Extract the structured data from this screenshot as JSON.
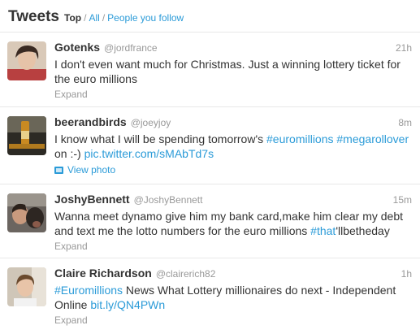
{
  "header": {
    "title": "Tweets",
    "filter_top": "Top",
    "sep1": "/",
    "filter_all": "All",
    "sep2": "/",
    "filter_follow": "People you follow"
  },
  "tweets": [
    {
      "name": "Gotenks",
      "handle": "@jordfrance",
      "time": "21h",
      "text": "I don't even want much for Christmas. Just a winning lottery ticket for the euro millions",
      "action": "Expand"
    },
    {
      "name": "beerandbirds",
      "handle": "@joeyjoy",
      "time": "8m",
      "text_pre": "I know what I will be spending tomorrow's ",
      "hashtag1": "#euromillions",
      "hashtag2": "#megarollover",
      "text_mid": " on :-) ",
      "link": "pic.twitter.com/sMAbTd7s",
      "action": "View photo"
    },
    {
      "name": "JoshyBennett",
      "handle": "@JoshyBennett",
      "time": "15m",
      "text_pre": "Wanna meet dynamo give him my bank card,make him clear my debt and text me the lotto numbers for the euro millions ",
      "hashtag": "#that",
      "text_post": "'llbetheday",
      "action": "Expand"
    },
    {
      "name": "Claire Richardson",
      "handle": "@clairerich82",
      "time": "1h",
      "hashtag": "#Euromillions",
      "text_mid": " News What Lottery millionaires do next - Independent Online ",
      "link": "bit.ly/QN4PWn",
      "action": "Expand"
    }
  ]
}
